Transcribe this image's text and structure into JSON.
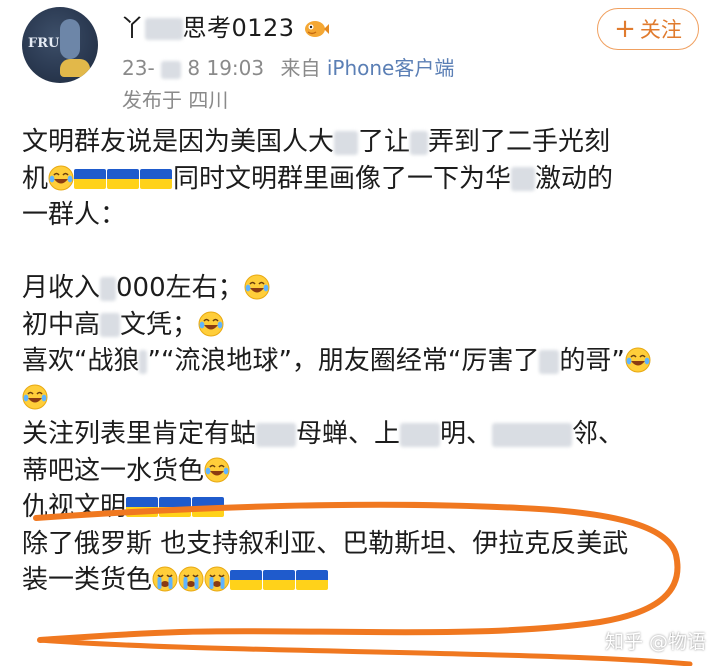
{
  "header": {
    "username_prefix": "丫",
    "username_suffix": "思考0123",
    "follow_label": "关注",
    "follow_plus": "+",
    "timestamp_prefix": "23-",
    "timestamp_suffix": "8 19:03",
    "source_prefix": "来自",
    "source_device": "iPhone客户端",
    "location": "发布于 四川"
  },
  "avatar": {
    "text": "FRU"
  },
  "post": {
    "l1": "文明群友说是因为美国人大",
    "l1b": "了让",
    "l1c": "弄到了二手光刻",
    "l2a": "机",
    "l2b": "同时文明群里画像了一下为华",
    "l2c": "激动的",
    "l3": "一群人：",
    "l4a": "月收入",
    "l4b": "000左右；",
    "l5a": "初中高",
    "l5b": "文凭；",
    "l6a": "喜欢“战狼",
    "l6b": "”“流浪地",
    "l6c": "球”，朋友圈经常“厉害了",
    "l6d": "的哥”",
    "l8a": "关注列表里肯定有蛄",
    "l8b": "母蝉、上",
    "l8c": "明、",
    "l8d": "邻、",
    "l9": "蒂吧这一水货色",
    "l10a": "仇视文明",
    "l11": "除了俄罗斯 也支持叙利亚、巴勒斯坦、伊拉克反美武",
    "l12": "装一类货色"
  },
  "watermark": "知乎 @物语",
  "colors": {
    "accent": "#e07b2e",
    "link": "#5b7fb5",
    "ink": "#f07820",
    "flag_blue": "#1f5bcc",
    "flag_yellow": "#ffd21a"
  },
  "icons": [
    "laugh-cry-emoji",
    "ukraine-flag-emoji",
    "crying-emoji",
    "pufferfish-badge-icon"
  ]
}
